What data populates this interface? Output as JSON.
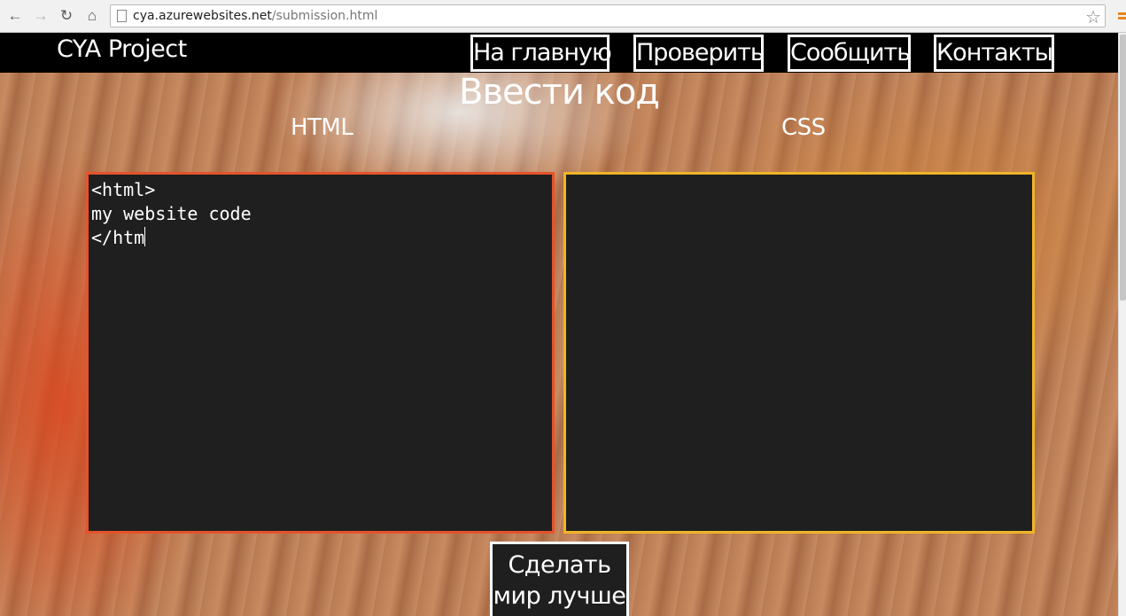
{
  "browser": {
    "back_icon": "←",
    "forward_icon": "→",
    "reload_icon": "↻",
    "home_icon": "⌂",
    "url_domain": "cya.azurewebsites.net",
    "url_path": "/submission.html",
    "star_icon": "☆"
  },
  "header": {
    "logo": "CYA Project",
    "nav": [
      {
        "label": "На главную"
      },
      {
        "label": "Проверить"
      },
      {
        "label": "Сообщить"
      },
      {
        "label": "Контакты"
      }
    ]
  },
  "main": {
    "title": "Ввести код",
    "html_label": "HTML",
    "css_label": "CSS",
    "html_code": "<html>\nmy website code\n</htm",
    "css_code": "",
    "submit_label_line1": "Сделать",
    "submit_label_line2": "мир лучше"
  },
  "colors": {
    "html_border": "#e5532a",
    "css_border": "#f0b429",
    "editor_bg": "#1f1f1f"
  }
}
